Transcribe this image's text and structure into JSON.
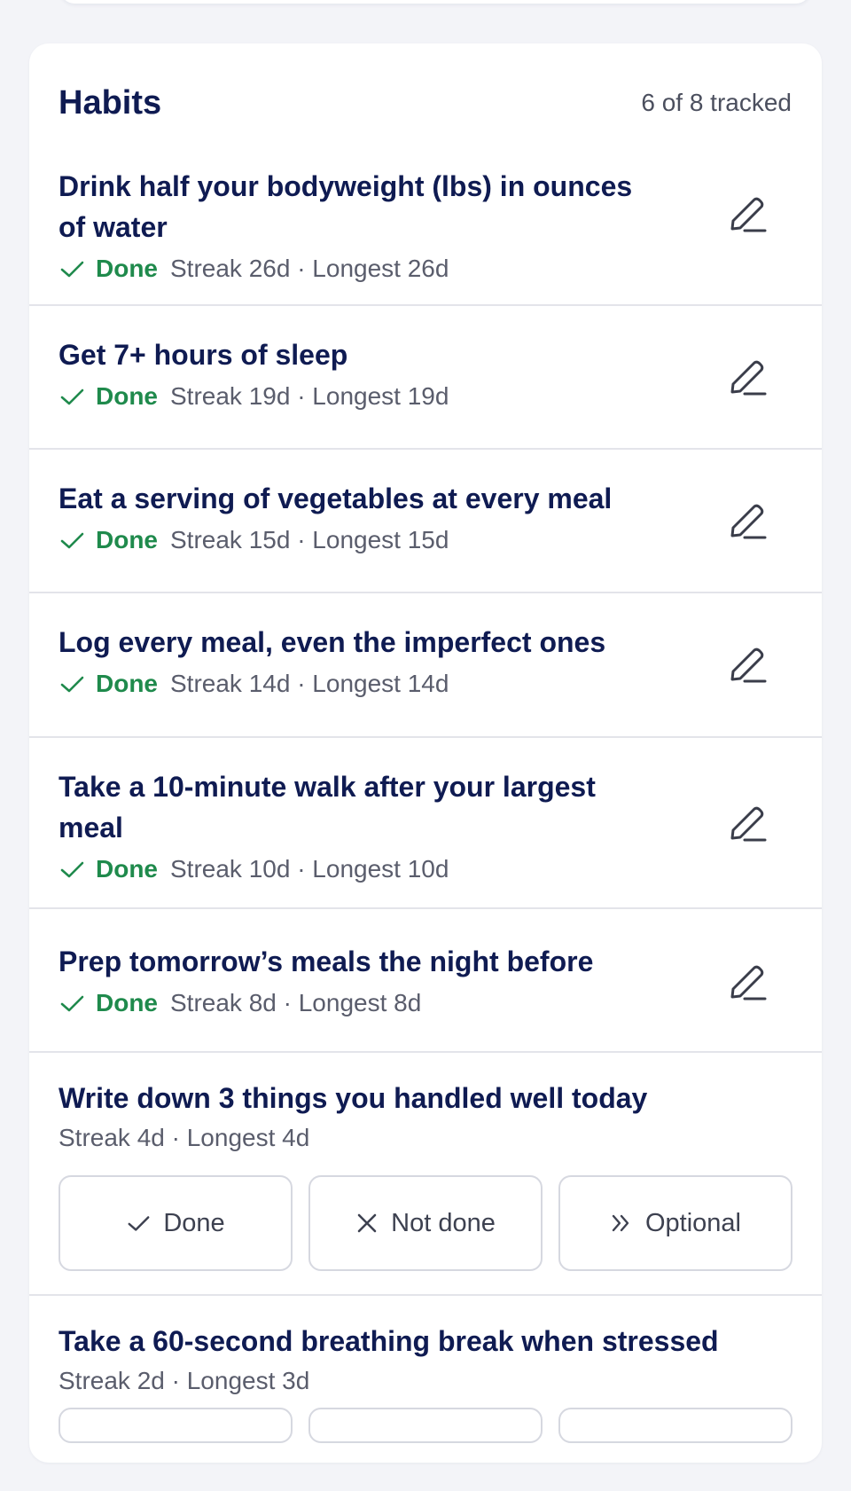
{
  "header": {
    "title": "Habits",
    "tracked": "6 of 8 tracked"
  },
  "status": {
    "done": "Done"
  },
  "habits": [
    {
      "name": "Drink half your bodyweight (lbs) in ounces of water",
      "streak": "Streak 26d · Longest 26d"
    },
    {
      "name": "Get 7+ hours of sleep",
      "streak": "Streak 19d · Longest 19d"
    },
    {
      "name": "Eat a serving of vegetables at every meal",
      "streak": "Streak 15d · Longest 15d"
    },
    {
      "name": "Log every meal, even the imperfect ones",
      "streak": "Streak 14d · Longest 14d"
    },
    {
      "name": "Take a 10-minute walk after your largest meal",
      "streak": "Streak 10d · Longest 10d"
    },
    {
      "name": "Prep tomorrow’s meals the night before",
      "streak": "Streak 8d · Longest 8d"
    },
    {
      "name": "Write down 3 things you handled well today",
      "streak": "Streak 4d · Longest 4d"
    },
    {
      "name": "Take a 60-second breathing break when stressed",
      "streak": "Streak 2d · Longest 3d"
    }
  ],
  "choices": {
    "done": "Done",
    "not_done": "Not done",
    "optional": "Optional"
  },
  "colors": {
    "accent_green": "#1f8a4c",
    "title_navy": "#0f1b52",
    "muted": "#5a5d6c"
  },
  "icons": {
    "check": "check-icon",
    "edit": "pencil-icon",
    "close": "x-icon",
    "skip": "double-chevron-right-icon"
  }
}
